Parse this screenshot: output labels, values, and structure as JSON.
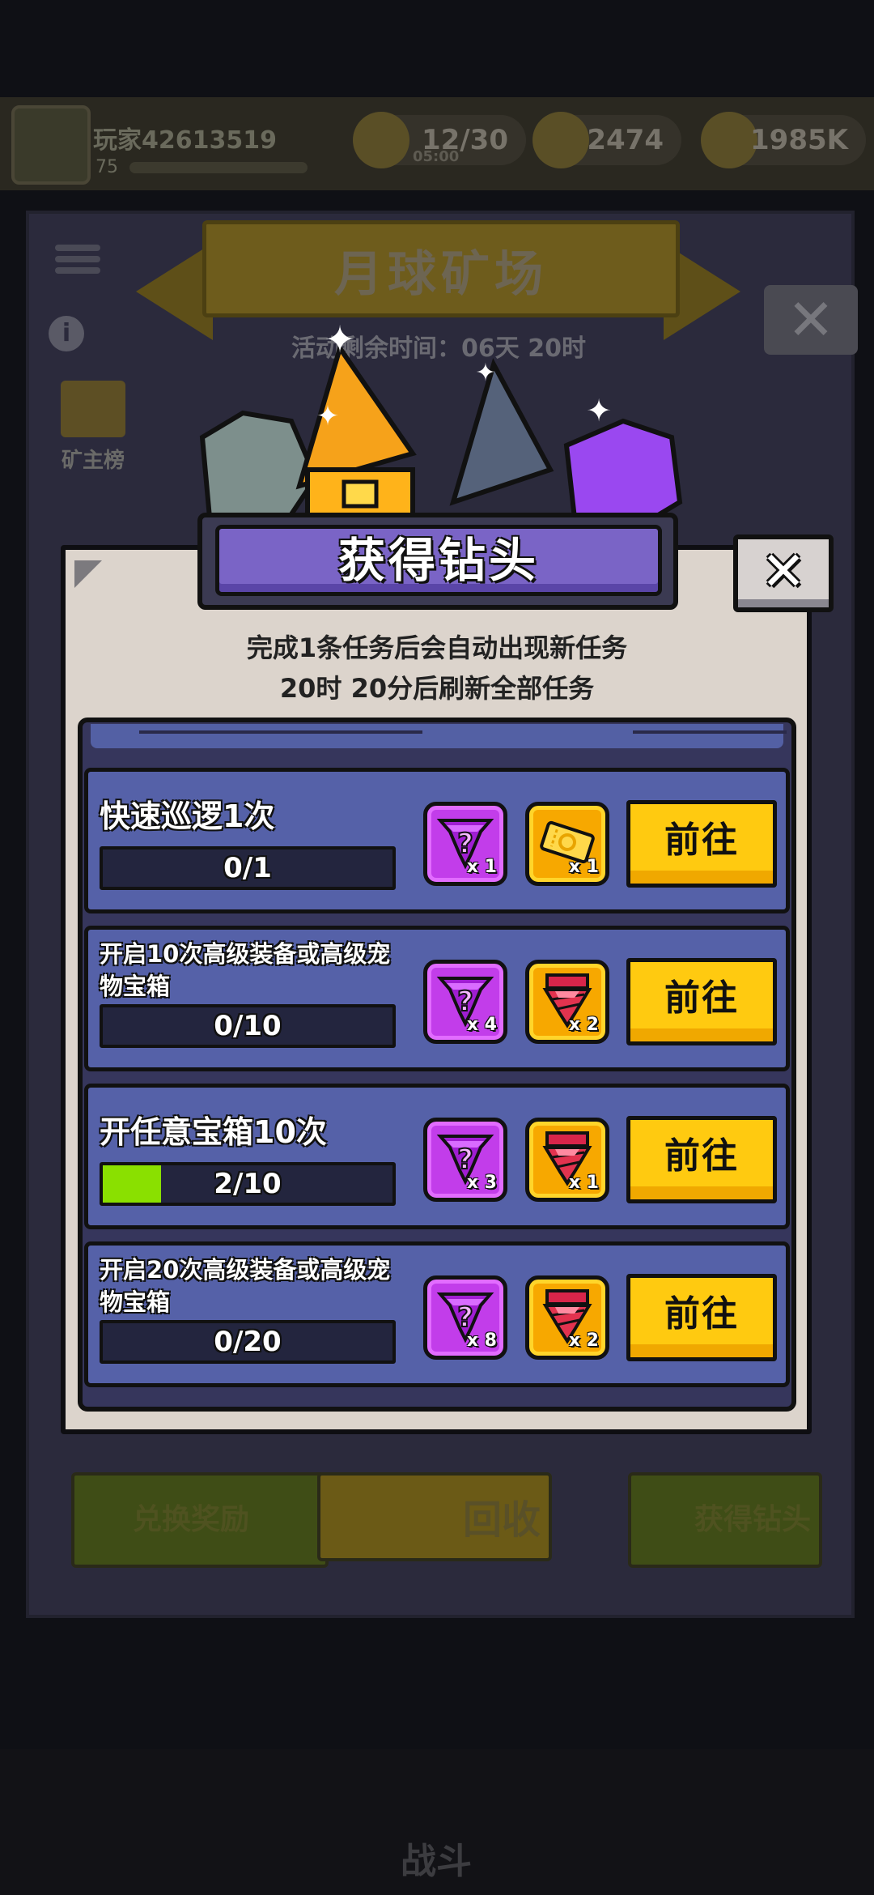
{
  "background": {
    "player_name": "玩家42613519",
    "player_level": "75",
    "stamina": "12/30",
    "stamina_timer": "05:00",
    "currency1": "2474",
    "currency2": "1985K",
    "banner_title": "月球矿场",
    "event_timer": "活动剩余时间：06天 20时",
    "ranking_label": "矿主榜",
    "btn_exchange": "兑换奖励",
    "btn_recycle": "回收",
    "btn_get_drill": "获得钻头",
    "nav_battle": "战斗"
  },
  "popup": {
    "title": "获得钻头",
    "info_line1": "完成1条任务后会自动出现新任务",
    "info_line2": "20时 20分后刷新全部任务",
    "go_label": "前往",
    "tasks": [
      {
        "title": "快速巡逻1次",
        "progress_text": "0/1",
        "progress": 0.0,
        "reward1": {
          "icon": "mystery-drill-icon",
          "qty": "x 1"
        },
        "reward2": {
          "icon": "ticket-icon",
          "qty": "x 1"
        }
      },
      {
        "title": "开启10次高级装备或高级宠物宝箱",
        "progress_text": "0/10",
        "progress": 0.0,
        "reward1": {
          "icon": "mystery-drill-icon",
          "qty": "x 4"
        },
        "reward2": {
          "icon": "red-drill-icon",
          "qty": "x 2"
        }
      },
      {
        "title": "开任意宝箱10次",
        "progress_text": "2/10",
        "progress": 0.2,
        "reward1": {
          "icon": "mystery-drill-icon",
          "qty": "x 3"
        },
        "reward2": {
          "icon": "red-drill-icon",
          "qty": "x 1"
        }
      },
      {
        "title": "开启20次高级装备或高级宠物宝箱",
        "progress_text": "0/20",
        "progress": 0.0,
        "reward1": {
          "icon": "mystery-drill-icon",
          "qty": "x 8"
        },
        "reward2": {
          "icon": "red-drill-icon",
          "qty": "x 2"
        }
      }
    ]
  },
  "colors": {
    "go_button": "#ffca10",
    "title_plate": "#7a64c6",
    "task_bg": "#5561a8",
    "progress_fill": "#8ae000",
    "reward_purple": "#c23dea",
    "reward_gold": "#f7a800"
  }
}
